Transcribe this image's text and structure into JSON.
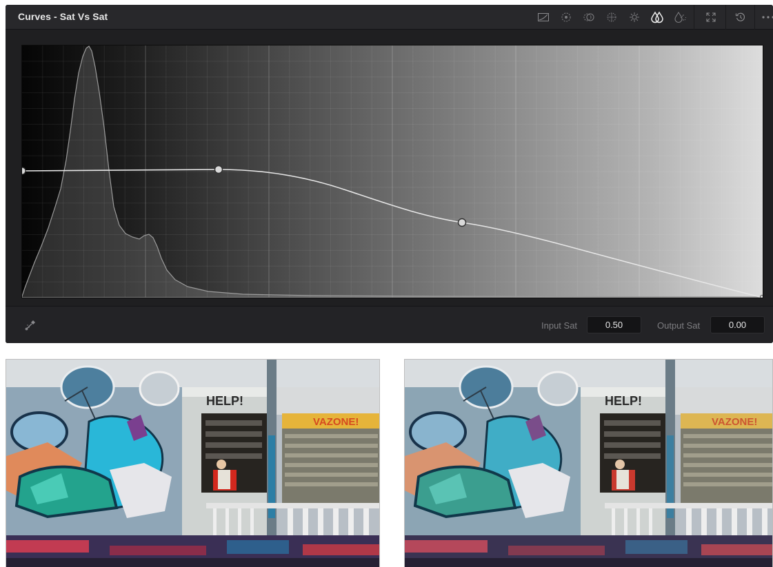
{
  "panel": {
    "title": "Curves - Sat Vs Sat",
    "toolbar": [
      {
        "name": "curve-mode-icon"
      },
      {
        "name": "hue-vs-hue-icon"
      },
      {
        "name": "hue-vs-sat-icon"
      },
      {
        "name": "hue-vs-lum-icon"
      },
      {
        "name": "lum-vs-sat-icon"
      },
      {
        "name": "sat-vs-sat-icon",
        "active": true
      },
      {
        "name": "sat-vs-lum-icon"
      },
      {
        "name": "expand-icon"
      },
      {
        "name": "reset-icon"
      },
      {
        "name": "more-options-icon"
      }
    ]
  },
  "curve": {
    "control_points": [
      {
        "input": 0.0,
        "output": 0.5
      },
      {
        "input": 0.265,
        "output": 0.505
      },
      {
        "input": 0.595,
        "output": 0.295
      },
      {
        "input": 1.0,
        "output": 0.0
      }
    ]
  },
  "footer": {
    "input_label": "Input Sat",
    "input_value": "0.50",
    "output_label": "Output Sat",
    "output_value": "0.00"
  },
  "images": {
    "left": {
      "name": "original-graffiti-image"
    },
    "right": {
      "name": "graded-graffiti-image"
    }
  },
  "colors": {
    "panel_bg": "#1f1f21",
    "header_bg": "#28282b",
    "curve_line": "#e6e6e6",
    "control_point": "#d9d9d9"
  }
}
